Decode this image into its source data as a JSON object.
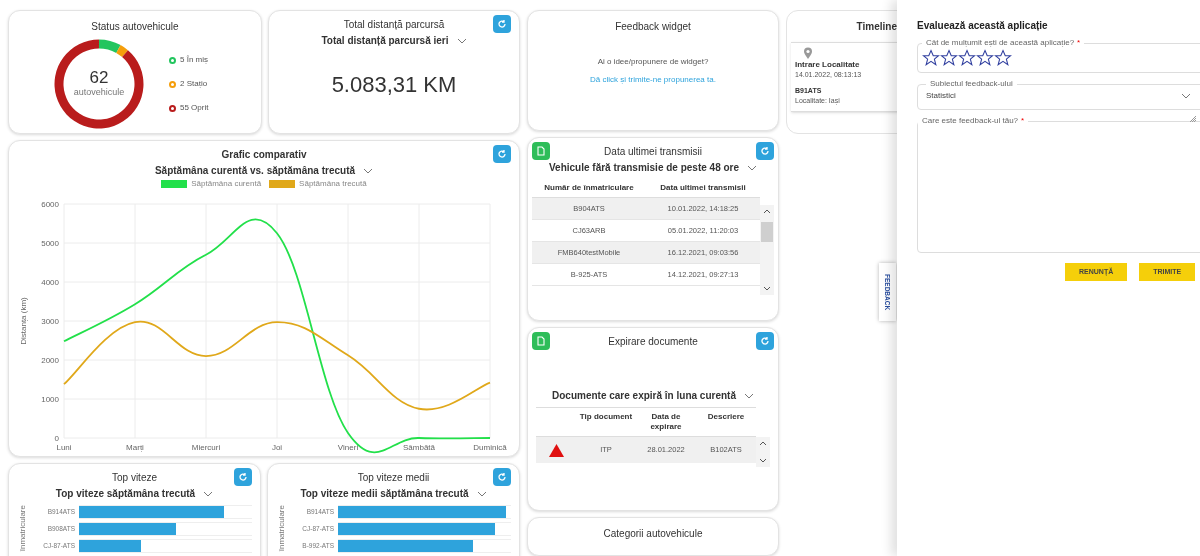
{
  "status_card": {
    "title": "Status autovehicule",
    "total": "62",
    "total_label": "autovehicule",
    "segments": [
      {
        "color": "#22c55e"
      },
      {
        "color": "#f59e0b"
      },
      {
        "color": "#b91c1c"
      }
    ],
    "chart_data": {
      "type": "donut",
      "categories": [
        "5 În miș",
        "2 Stațio",
        "55 Oprit"
      ],
      "values": [
        5,
        2,
        55
      ]
    }
  },
  "distance_card": {
    "title": "Total distanță parcursă",
    "period": "Total distanță parcursă ieri",
    "value": "5.083,31 KM"
  },
  "feedback_widget": {
    "title": "Feedback widget",
    "question": "Ai o idee/propunere de widget?",
    "link": "Dă click și trimite-ne propunerea ta."
  },
  "timeline": {
    "title": "Timeline",
    "event": {
      "title": "Intrare Localitate",
      "time": "14.01.2022, 08:13:13",
      "vehicle": "B91ATS",
      "place": "Localitate: Iași"
    }
  },
  "comparison_chart": {
    "title": "Grafic comparativ",
    "period": "Săptămâna curentă vs. săptămâna trecută",
    "chart_data": {
      "type": "line",
      "grid": true,
      "legend": "top",
      "ylabel": "Distanța (km)",
      "categories": [
        "Luni",
        "Marți",
        "Miercuri",
        "Joi",
        "Vineri",
        "Sâmbătă",
        "Duminică"
      ],
      "ylim": [
        0,
        6000
      ],
      "yticks": [
        0,
        1000,
        2000,
        3000,
        4000,
        5000,
        6000
      ],
      "series": [
        {
          "name": "Săptămâna curentă",
          "color": "#22e04a",
          "values": [
            2480,
            3430,
            4700,
            5250,
            130,
            0,
            0
          ]
        },
        {
          "name": "Săptămâna trecută",
          "color": "#e0a81a",
          "values": [
            1380,
            2970,
            2100,
            2970,
            2120,
            750,
            1420
          ]
        }
      ]
    }
  },
  "transmission_card": {
    "title": "Data ultimei transmisii",
    "filter": "Vehicule fără transmisie de peste 48 ore",
    "columns": [
      "Număr de înmatriculare",
      "Data ultimei transmisii"
    ],
    "rows": [
      [
        "B904ATS",
        "10.01.2022, 14:18:25"
      ],
      [
        "CJ63ARB",
        "05.01.2022, 11:20:03"
      ],
      [
        "FMB640testMobile",
        "16.12.2021, 09:03:56"
      ],
      [
        "B-925-ATS",
        "14.12.2021, 09:27:13"
      ]
    ]
  },
  "documents_card": {
    "title": "Expirare documente",
    "filter": "Documente care expiră în luna curentă",
    "columns": [
      "Tip document",
      "Data de expirare",
      "Descriere"
    ],
    "rows": [
      {
        "warning": true,
        "cells": [
          "ITP",
          "28.01.2022",
          "B102ATS"
        ]
      }
    ]
  },
  "categories_card": {
    "title": "Categorii autovehicule"
  },
  "speed_cards": [
    {
      "title": "Top viteze",
      "period": "Top viteze săptămâna trecută",
      "axis_label": "înmatriculare",
      "bars": [
        {
          "label": "B914ATS",
          "level": 0.84
        },
        {
          "label": "B908ATS",
          "level": 0.56
        },
        {
          "label": "CJ-87-ATS",
          "level": 0.36
        }
      ]
    },
    {
      "title": "Top viteze medii",
      "period": "Top viteze medii săptămâna trecută",
      "axis_label": "înmatriculare",
      "bars": [
        {
          "label": "B914ATS",
          "level": 0.97
        },
        {
          "label": "CJ-87-ATS",
          "level": 0.91
        },
        {
          "label": "B-992-ATS",
          "level": 0.78
        }
      ]
    }
  ],
  "feedback_tab": "FEEDBACK",
  "rating_form": {
    "title": "Evaluează această aplicație",
    "rating_label": "Cât de mulțumit ești de această aplicație?",
    "rating_required": true,
    "required_mark": "*",
    "stars": 0,
    "subject_label": "Subiectul feedback-ului",
    "subject_value": "Statistici",
    "feedback_label": "Care este feedback-ul tău?",
    "feedback_required": true,
    "buttons": [
      "RENUNȚĂ",
      "TRIMITE"
    ]
  }
}
